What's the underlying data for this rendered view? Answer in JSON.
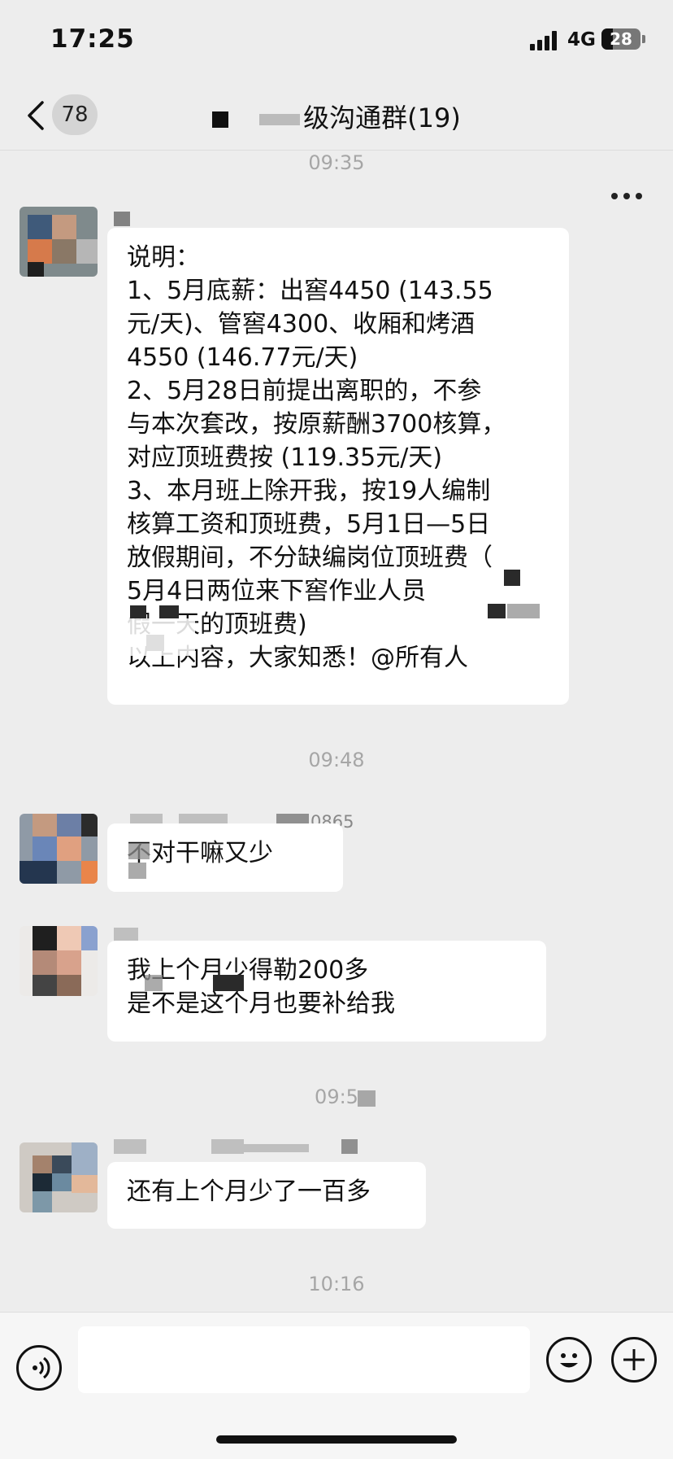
{
  "status_bar": {
    "time": "17:25",
    "network": "4G",
    "battery": "28"
  },
  "nav": {
    "unread_count": "78",
    "title": "级沟通群(19)"
  },
  "messages": [
    {
      "timestamp": "09:35",
      "text": "说明：\n1、5月底薪：出窖4450 (143.55\n元/天)、管窖4300、收厢和烤酒\n4550 (146.77元/天)\n2、5月28日前提出离职的，不参\n与本次套改，按原薪酬3700核算，\n对应顶班费按 (119.35元/天)\n3、本月班上除开我，按19人编制\n核算工资和顶班费，5月1日—5日\n放假期间，不分缺编岗位顶班费（\n5月4日两位来下窖作业人员\n假一天的顶班费)\n以上内容，大家知悉！@所有人"
    },
    {
      "timestamp": "09:48",
      "sender": "0865",
      "text": "不对干嘛又少"
    },
    {
      "text": "我上个月少得勒200多\n是不是这个月也要补给我"
    },
    {
      "timestamp": "09:5",
      "text": "还有上个月少了一百多"
    },
    {
      "timestamp": "10:16"
    }
  ],
  "input": {
    "value": "",
    "placeholder": ""
  },
  "icons": {
    "back": "back-chevron-icon",
    "more": "more-dots-icon",
    "voice": "voice-icon",
    "emoji": "emoji-icon",
    "plus": "plus-icon"
  },
  "colors": {
    "background": "#ededed",
    "bubble": "#ffffff",
    "timestamp": "#a6a6a6",
    "text": "#111111"
  }
}
